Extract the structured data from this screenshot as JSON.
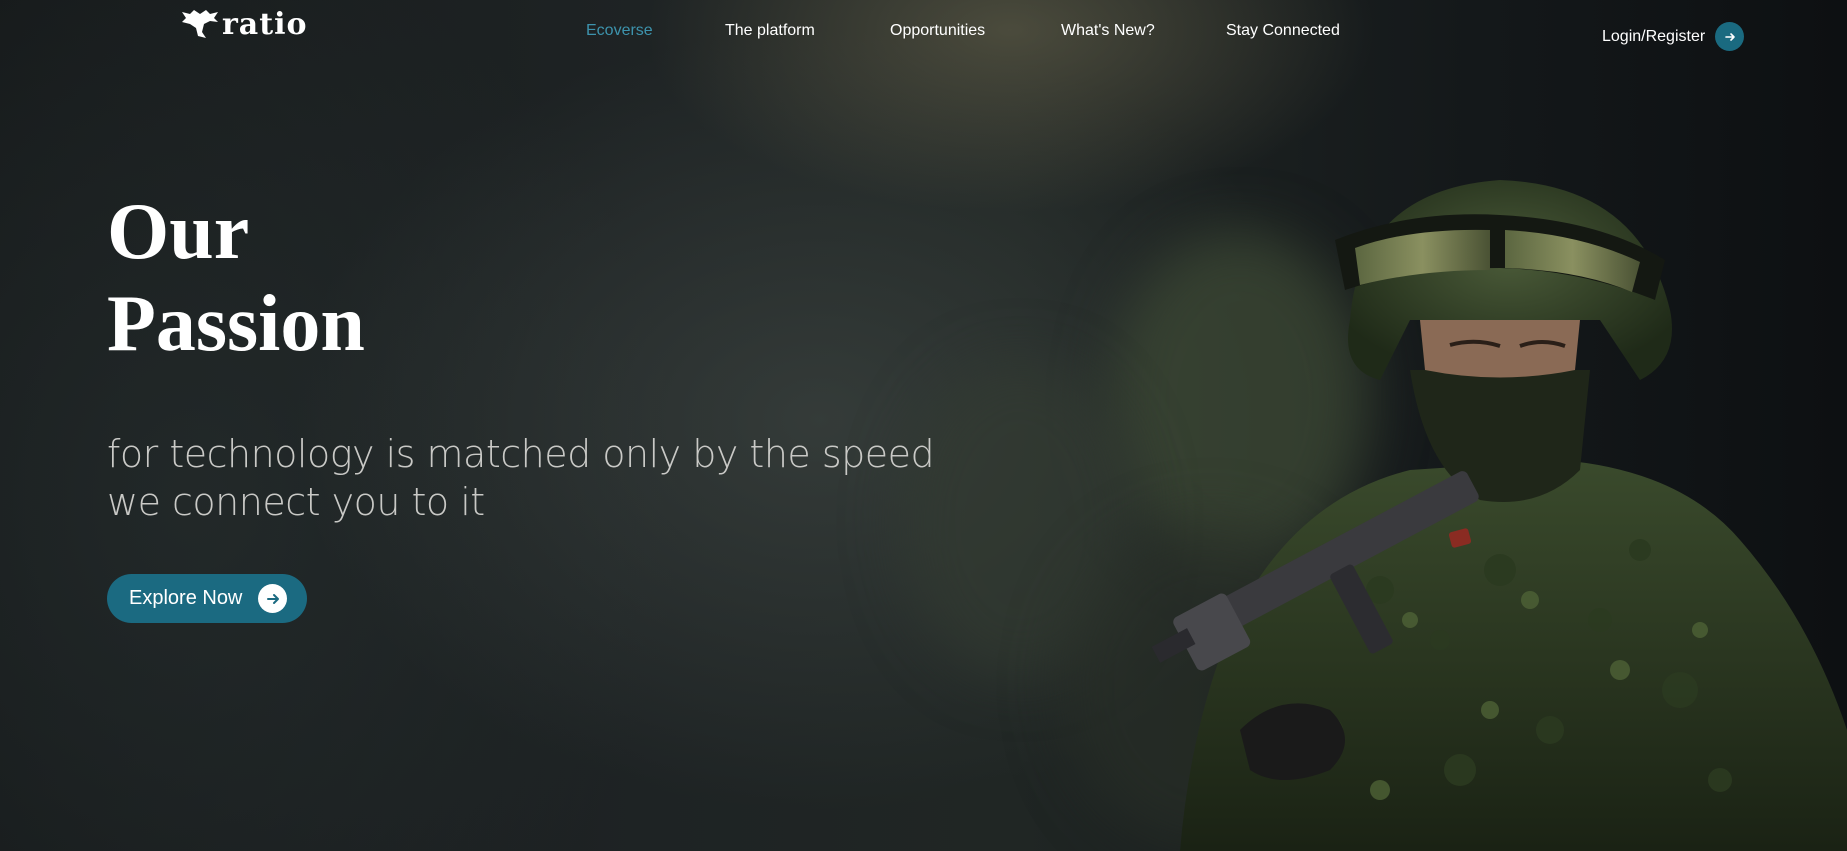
{
  "header": {
    "logo_alt": "ratio",
    "logo_text": "ratio",
    "nav": [
      {
        "label": "Ecoverse",
        "active": true
      },
      {
        "label": "The platform",
        "active": false
      },
      {
        "label": "Opportunities",
        "active": false
      },
      {
        "label": "What's New?",
        "active": false
      },
      {
        "label": "Stay Connected",
        "active": false
      }
    ],
    "login_label": "Login/Register",
    "login_icon": "arrow-right-icon"
  },
  "hero": {
    "title_line1": "Our",
    "title_line2": "Passion",
    "subtitle": "for technology is matched only by the speed we connect you to it",
    "cta_label": "Explore Now",
    "cta_icon": "arrow-right-circle-icon",
    "image_alt": "soldier"
  },
  "colors": {
    "accent": "#1b6a81",
    "nav_active": "#3d93ad",
    "background": "#16191a",
    "subtitle": "#c9c9c6"
  }
}
